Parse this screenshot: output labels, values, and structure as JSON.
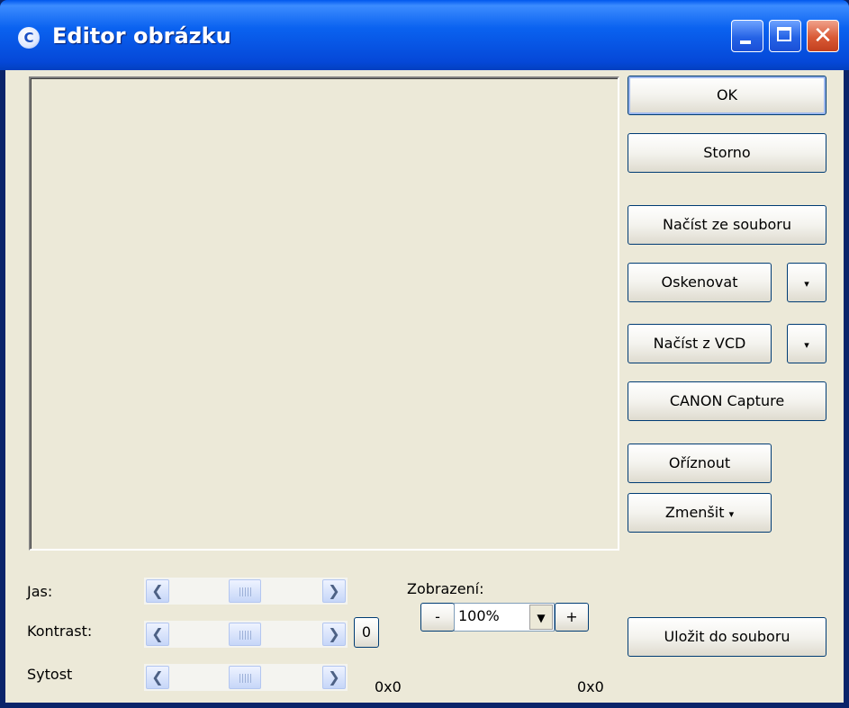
{
  "window": {
    "title": "Editor obrázku",
    "app_icon_glyph": "C"
  },
  "buttons": {
    "ok": "OK",
    "storno": "Storno",
    "load_file": "Načíst ze souboru",
    "scan": "Oskenovat",
    "load_vcd": "Načíst z VCD",
    "canon": "CANON Capture",
    "crop": "Oříznout",
    "shrink": "Zmenšit",
    "save_file": "Uložit do souboru",
    "reset": "0",
    "zoom_out": "-",
    "zoom_in": "+"
  },
  "adjust": {
    "brightness_label": "Jas:",
    "contrast_label": "Kontrast:",
    "saturation_label": "Sytost"
  },
  "zoom": {
    "label": "Zobrazení:",
    "value": "100%"
  },
  "sizes": {
    "original": "0x0",
    "result": "0x0"
  },
  "icons": {
    "arrow_left": "❮",
    "arrow_right": "❯",
    "dropdown": "▾",
    "combo_drop": "▼",
    "close": "✕"
  },
  "colors": {
    "titlebar": "#0a62f0",
    "client": "#ece9d8",
    "close_button": "#d95a36"
  }
}
